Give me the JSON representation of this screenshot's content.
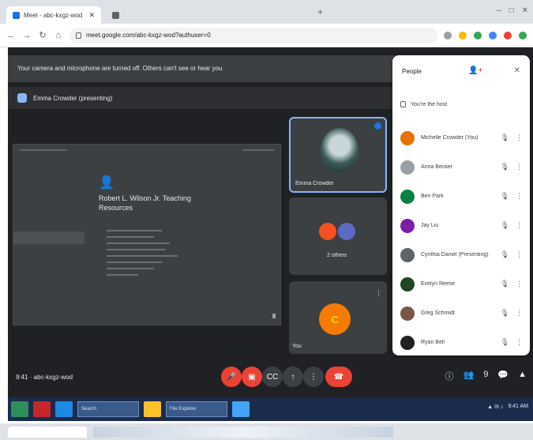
{
  "browser": {
    "tabs": [
      {
        "title": "Meet - abc-kxgz-wod"
      },
      {
        "title": ""
      }
    ],
    "url": "meet.google.com/abc-kxgz-wod?authuser=0",
    "window_controls": [
      "–",
      "□",
      "✕"
    ]
  },
  "meet": {
    "notice_text": "Your camera and microphone are turned off. Others can't see or hear you",
    "presenting_text": "Emma Crowder (presenting)",
    "shared_doc": {
      "title": "Robert L. Wilson Jr. Teaching Resources"
    },
    "tiles": [
      {
        "name": "Emma Crowder",
        "speaking": true
      },
      {
        "name": "2 others"
      },
      {
        "name": "You",
        "initial": "C"
      }
    ],
    "people_panel": {
      "header": "People",
      "you_label": "You're the host",
      "participants": [
        {
          "name": "Michelle Crowder (You)",
          "color": "#e37400"
        },
        {
          "name": "Anna Becker",
          "color": "#9aa0a6"
        },
        {
          "name": "Ben Park",
          "color": "#0b8043"
        },
        {
          "name": "Jay Liu",
          "color": "#7b1fa2"
        },
        {
          "name": "Cynthia Daniel (Presenting)",
          "color": "#5f6368"
        },
        {
          "name": "Evelyn Reese",
          "color": "#1e4620"
        },
        {
          "name": "Greg Schmidt",
          "color": "#795548"
        },
        {
          "name": "Ryan Bell",
          "color": "#202124"
        }
      ]
    },
    "controls": {
      "meeting_info": "9:41 · abc-kxgz-wod",
      "mic_icon": "mic-off",
      "cam_icon": "cam-off",
      "cc_icon": "captions",
      "present_icon": "present",
      "more_icon": "more",
      "end_icon": "end-call",
      "participant_count": "9"
    },
    "colors": {
      "danger": "#ea4335",
      "neutral": "#3c4043",
      "accent": "#8ab4f8"
    }
  },
  "taskbar": {
    "apps": [
      "Search",
      "Edge",
      "File Explorer",
      "Chrome"
    ],
    "clock": "9:41 AM"
  }
}
